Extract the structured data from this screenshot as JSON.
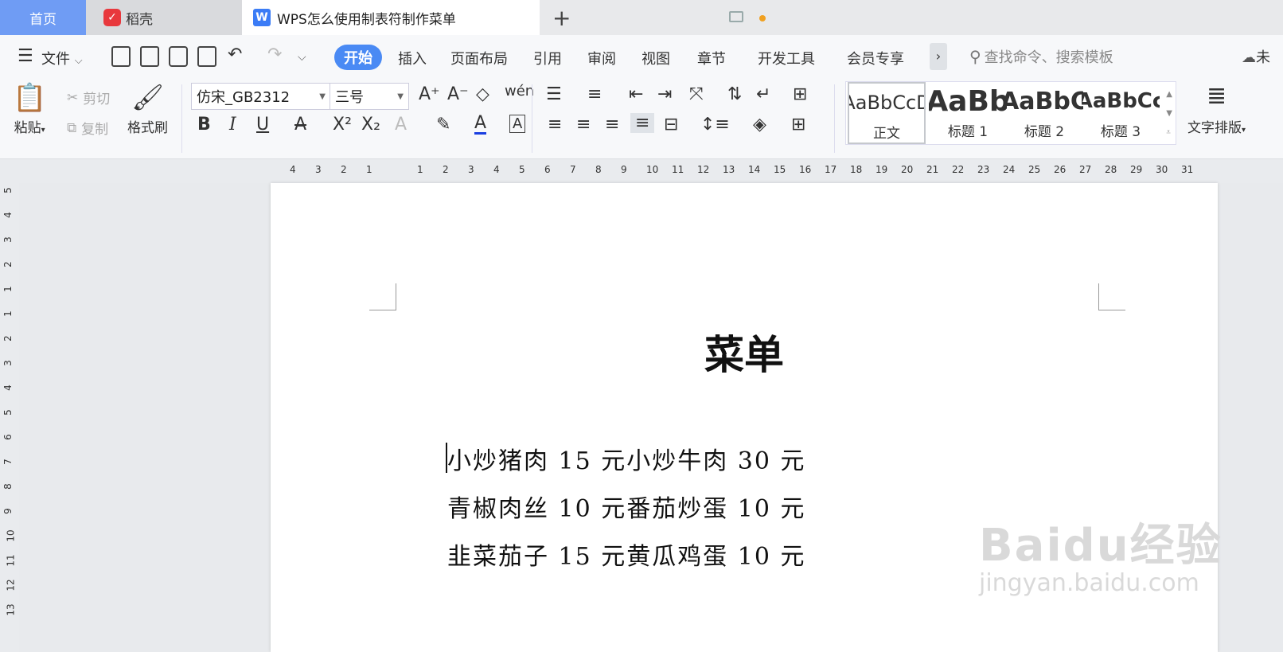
{
  "tabs": {
    "home": "首页",
    "daoke": "稻壳",
    "document": "WPS怎么使用制表符制作菜单"
  },
  "menu": {
    "file": "文件",
    "items": [
      "开始",
      "插入",
      "页面布局",
      "引用",
      "审阅",
      "视图",
      "章节",
      "开发工具",
      "会员专享"
    ],
    "search_placeholder": "查找命令、搜索模板",
    "right_partial": "未"
  },
  "ribbon": {
    "paste": "粘贴",
    "cut": "剪切",
    "copy": "复制",
    "format_painter": "格式刷",
    "font_name": "仿宋_GB2312",
    "font_size": "三号",
    "text_layout": "文字排版",
    "styles": [
      {
        "preview": "AaBbCcD",
        "label": "正文"
      },
      {
        "preview": "AaBb",
        "label": "标题 1"
      },
      {
        "preview": "AaBbC",
        "label": "标题 2"
      },
      {
        "preview": "AaBbCc",
        "label": "标题 3"
      }
    ]
  },
  "ruler": {
    "left_ticks": [
      "4",
      "3",
      "2",
      "1"
    ],
    "right_ticks": [
      "1",
      "2",
      "3",
      "4",
      "5",
      "6",
      "7",
      "8",
      "9",
      "10",
      "11",
      "12",
      "13",
      "14",
      "15",
      "16",
      "17",
      "18",
      "19",
      "20",
      "21",
      "22",
      "23",
      "24",
      "25",
      "26",
      "27",
      "28",
      "29",
      "30",
      "31"
    ],
    "vertical_ticks": [
      "5",
      "4",
      "3",
      "2",
      "1",
      "1",
      "2",
      "3",
      "4",
      "5",
      "6",
      "7",
      "8",
      "9",
      "10",
      "11",
      "12",
      "13"
    ]
  },
  "document": {
    "title": "菜单",
    "lines": [
      "小炒猪肉 15 元小炒牛肉 30 元",
      "青椒肉丝 10 元番茄炒蛋 10 元",
      "韭菜茄子 15 元黄瓜鸡蛋 10 元"
    ]
  },
  "watermark": {
    "brand": "Baidu经验",
    "url": "jingyan.baidu.com"
  },
  "colors": {
    "accent": "#4a8af4",
    "home_tab": "#6f9cf4"
  }
}
